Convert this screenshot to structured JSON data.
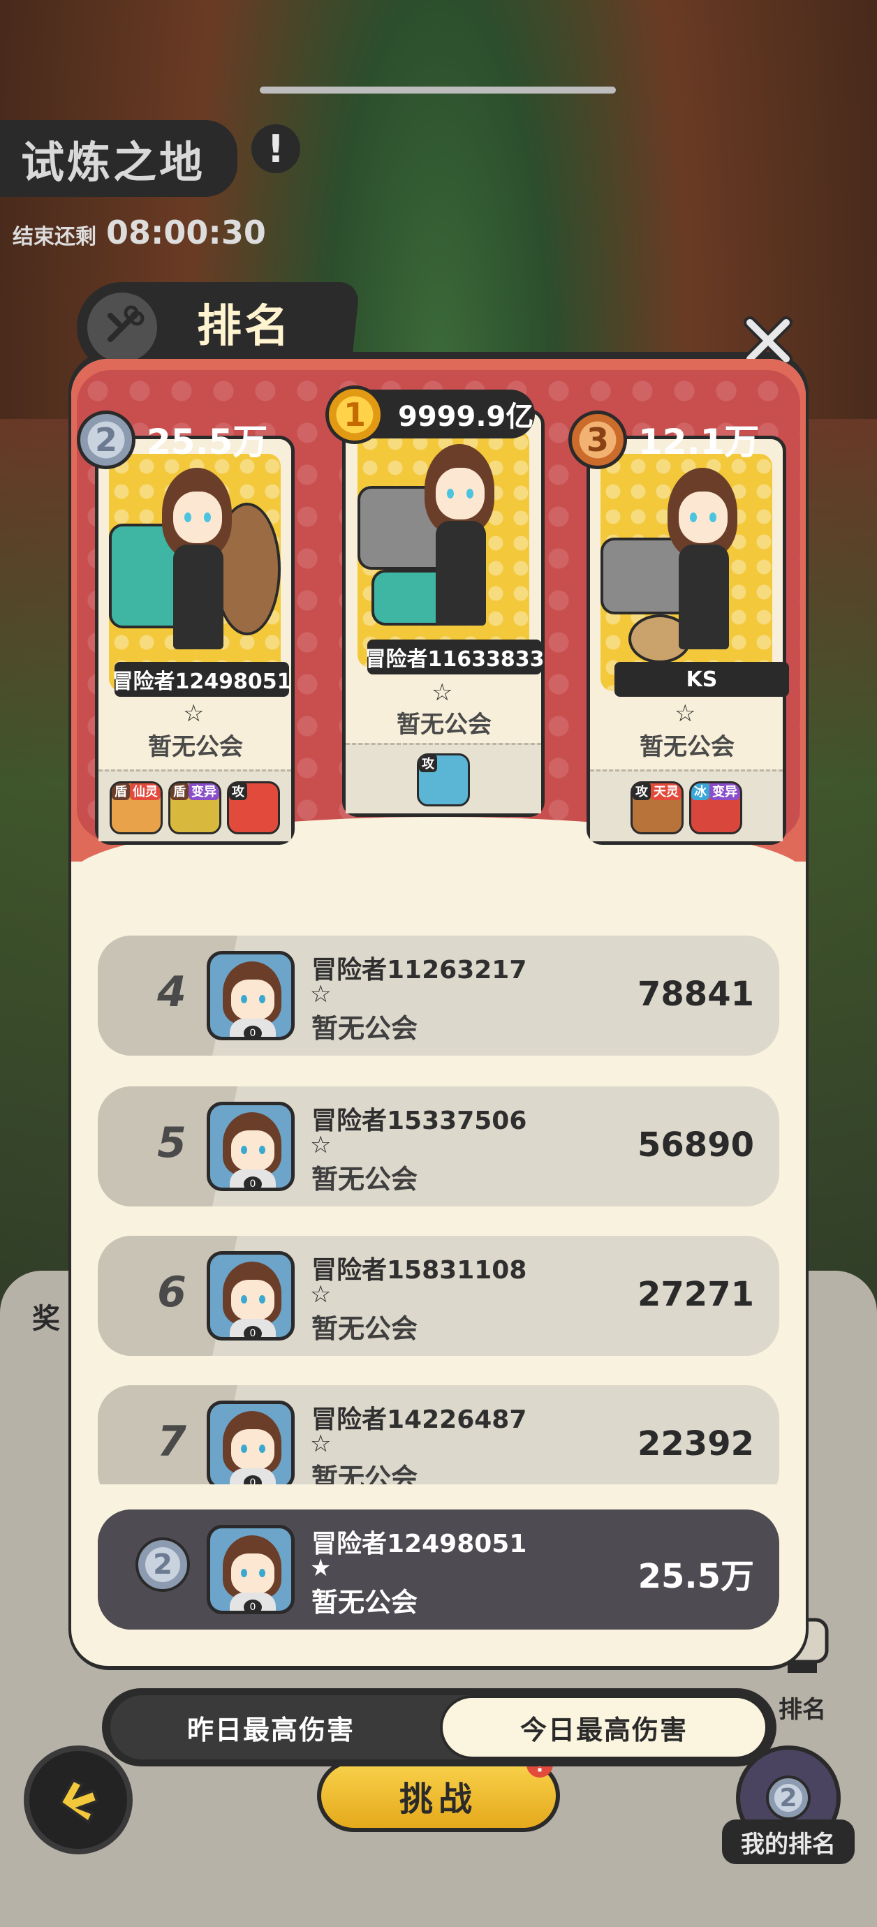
{
  "background": {
    "title": "试炼之地",
    "alert_icon": "exclamation-icon",
    "countdown_label": "结束还剩",
    "countdown_time": "08:00:30",
    "reward_label": "奖",
    "challenge_label": "挑战",
    "challenge_badge": "!",
    "rank_label": "排名",
    "my_rank_label": "我的排名",
    "my_rank_number": "2"
  },
  "modal": {
    "title": "排名",
    "close_icon": "close-icon",
    "podium": [
      {
        "rank": "2",
        "score": "25.5万",
        "name": "冒险者12498051",
        "guild": "暂无公会",
        "pets": [
          {
            "tag": "盾",
            "tag2": "仙灵",
            "color": "#e8a24a"
          },
          {
            "tag": "盾",
            "tag2": "变异",
            "color": "#d9b83e"
          },
          {
            "tag": "攻",
            "tag2": "",
            "color": "#e24a3b"
          }
        ]
      },
      {
        "rank": "1",
        "score": "9999.9亿",
        "name": "冒险者11633833",
        "guild": "暂无公会",
        "pets": [
          {
            "tag": "攻",
            "tag2": "",
            "color": "#5bb6d6"
          }
        ]
      },
      {
        "rank": "3",
        "score": "12.1万",
        "name": "KS",
        "guild": "暂无公会",
        "pets": [
          {
            "tag": "攻",
            "tag2": "天灵",
            "color": "#b8733a"
          },
          {
            "tag": "冰",
            "tag2": "变异",
            "color": "#d9463b"
          }
        ]
      }
    ],
    "rows": [
      {
        "rank": "4",
        "name": "冒险者11263217",
        "guild": "暂无公会",
        "score": "78841"
      },
      {
        "rank": "5",
        "name": "冒险者15337506",
        "guild": "暂无公会",
        "score": "56890"
      },
      {
        "rank": "6",
        "name": "冒险者15831108",
        "guild": "暂无公会",
        "score": "27271"
      },
      {
        "rank": "7",
        "name": "冒险者14226487",
        "guild": "暂无公会",
        "score": "22392"
      }
    ],
    "me": {
      "rank": "2",
      "name": "冒险者12498051",
      "guild": "暂无公会",
      "score": "25.5万"
    },
    "tabs": {
      "yesterday": "昨日最高伤害",
      "today": "今日最高伤害"
    }
  },
  "star_glyph": "☆",
  "star_filled_glyph": "★",
  "colors": {
    "accent": "#e06a5a",
    "gold": "#f3c83a",
    "dark": "#2b2b2b",
    "cream": "#f9f2df"
  }
}
